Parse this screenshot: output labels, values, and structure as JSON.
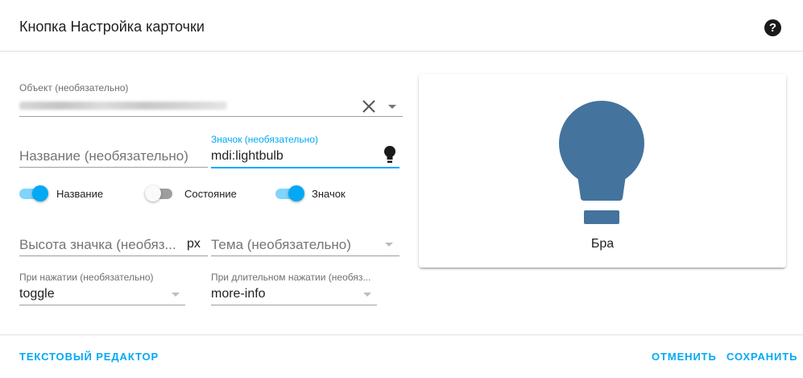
{
  "dialog": {
    "title": "Кнопка Настройка карточки"
  },
  "form": {
    "entity": {
      "label": "Объект (необязательно)",
      "value": ""
    },
    "name": {
      "placeholder": "Название (необязательно)"
    },
    "icon": {
      "label": "Значок (необязательно)",
      "value": "mdi:lightbulb"
    },
    "toggles": [
      {
        "label": "Название",
        "checked": true
      },
      {
        "label": "Состояние",
        "checked": false
      },
      {
        "label": "Значок",
        "checked": true
      }
    ],
    "icon_height": {
      "placeholder": "Высота значка (необяз...",
      "suffix": "px"
    },
    "theme": {
      "placeholder": "Тема (необязательно)"
    },
    "tap_action": {
      "label": "При нажатии (необязательно)",
      "value": "toggle"
    },
    "hold_action": {
      "label": "При длительном нажатии (необяз...",
      "value": "more-info"
    }
  },
  "preview": {
    "icon": "lightbulb-icon",
    "icon_color": "#44739e",
    "name": "Бра"
  },
  "footer": {
    "code_editor": "Текстовый редактор",
    "cancel": "Отменить",
    "save": "Сохранить"
  },
  "colors": {
    "accent": "#03a9f4",
    "icon": "#44739e"
  }
}
